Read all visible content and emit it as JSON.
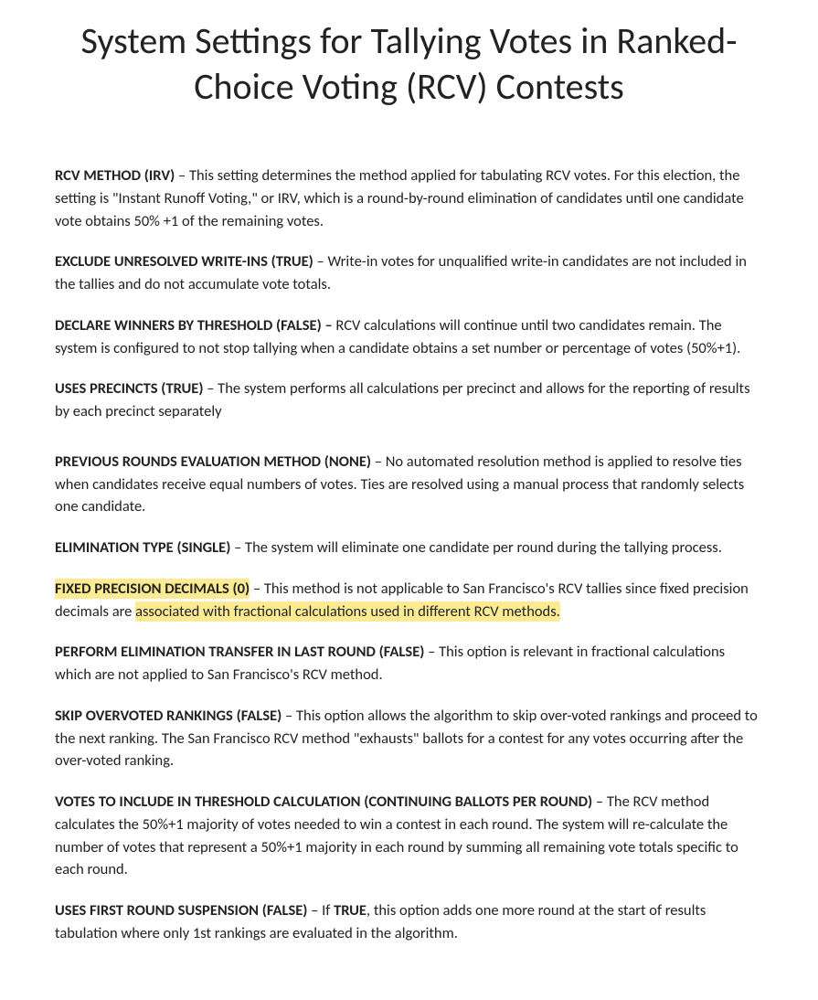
{
  "title": "System Settings for Tallying Votes in Ranked-Choice Voting (RCV) Contests",
  "settings": [
    {
      "label": "RCV METHOD (IRV)",
      "sep": " – ",
      "desc": "This setting determines the method applied for tabulating RCV votes.  For this election, the setting is \"Instant Runoff Voting,\" or IRV, which is a round-by-round elimination of candidates until one candidate vote obtains 50% +1 of the remaining votes.",
      "highlight_label": false,
      "highlight_tail": ""
    },
    {
      "label": "EXCLUDE UNRESOLVED WRITE-INS (TRUE)",
      "sep": " – ",
      "desc": "Write-in votes for unqualified write-in candidates are not included in the tallies and do not accumulate vote totals.",
      "highlight_label": false,
      "highlight_tail": ""
    },
    {
      "label": "DECLARE WINNERS BY THRESHOLD (FALSE) –",
      "sep": " ",
      "desc": "RCV calculations will continue until two candidates remain.  The system is configured to not stop tallying when a candidate obtains a set number or percentage of votes (50%+1).",
      "highlight_label": false,
      "highlight_tail": ""
    },
    {
      "label": "USES PRECINCTS (TRUE)",
      "sep": " – ",
      "desc": "The system performs all calculations per precinct and allows for the reporting of results by each precinct separately",
      "highlight_label": false,
      "highlight_tail": "",
      "gap_after": true
    },
    {
      "label": "PREVIOUS ROUNDS EVALUATION METHOD (NONE)",
      "sep": " – ",
      "desc": "No automated resolution method is applied to resolve ties when candidates receive equal numbers of votes.  Ties are resolved using a manual process that randomly selects one candidate.",
      "highlight_label": false,
      "highlight_tail": ""
    },
    {
      "label": "ELIMINATION TYPE (SINGLE)",
      "sep": " – ",
      "desc": "The system will eliminate one candidate per round during the tallying process.",
      "highlight_label": false,
      "highlight_tail": ""
    },
    {
      "label": "FIXED PRECISION DECIMALS (0)",
      "sep": " – ",
      "desc": "This method is not applicable to San Francisco's RCV tallies since fixed precision decimals are ",
      "highlight_label": true,
      "highlight_tail": "associated with fractional calculations used in different RCV methods."
    },
    {
      "label": "PERFORM ELIMINATION TRANSFER IN LAST ROUND (FALSE)",
      "sep": " – ",
      "desc": "This option is relevant in fractional calculations which are not applied to San Francisco's RCV method.",
      "highlight_label": false,
      "highlight_tail": ""
    },
    {
      "label": "SKIP OVERVOTED RANKINGS (FALSE)",
      "sep": " – ",
      "desc": "This option allows the algorithm to skip over-voted rankings and proceed to the next ranking.  The San Francisco RCV method \"exhausts\" ballots for a contest for any votes occurring after the over-voted ranking.",
      "highlight_label": false,
      "highlight_tail": ""
    },
    {
      "label": "VOTES TO INCLUDE IN THRESHOLD CALCULATION (CONTINUING BALLOTS PER ROUND)",
      "sep": " – ",
      "desc": "The RCV method calculates the 50%+1 majority of votes needed to win a contest in each round.  The system will re-calculate the number of votes that represent a 50%+1 majority in each round by summing all remaining vote totals specific to each round.",
      "highlight_label": false,
      "highlight_tail": ""
    },
    {
      "label": "USES FIRST ROUND SUSPENSION (FALSE)",
      "sep": " – ",
      "desc_prefix": "If ",
      "desc_bold": "TRUE",
      "desc": ", this option adds one more round at the start of results tabulation where only 1st rankings are evaluated in the algorithm.",
      "highlight_label": false,
      "highlight_tail": ""
    }
  ]
}
